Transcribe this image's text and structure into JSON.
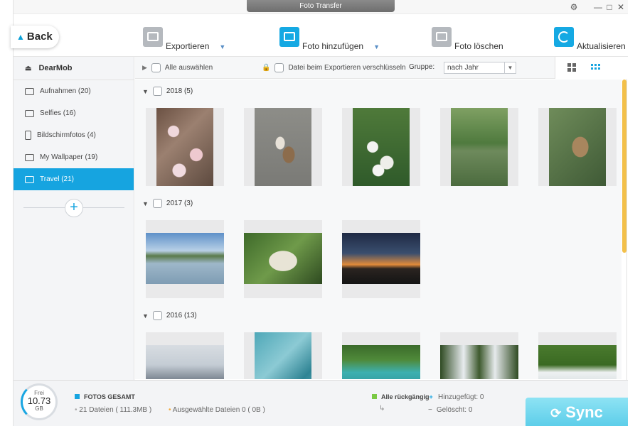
{
  "window": {
    "title": "Foto Transfer"
  },
  "titlebar": {
    "settings_icon": "gear-icon",
    "minimize": "—",
    "maximize": "□",
    "close": "✕"
  },
  "toolbar": {
    "back_label": "Back",
    "export_label": "Exportieren",
    "add_label": "Foto hinzufügen",
    "delete_label": "Foto löschen",
    "refresh_label": "Aktualisieren"
  },
  "sidebar": {
    "device": "DearMob",
    "albums": [
      {
        "label": "Aufnahmen (20)",
        "icon": "camera-icon"
      },
      {
        "label": "Selfies (16)",
        "icon": "camera-icon"
      },
      {
        "label": "Bildschirmfotos (4)",
        "icon": "phone-icon"
      },
      {
        "label": "My Wallpaper (19)",
        "icon": "image-icon"
      },
      {
        "label": "Travel (21)",
        "icon": "image-icon",
        "active": true
      }
    ],
    "add_label": "+"
  },
  "filterbar": {
    "select_all": "Alle auswählen",
    "encrypt": "Datei beim Exportieren verschlüsseln",
    "group_label": "Gruppe:",
    "group_value": "nach Jahr"
  },
  "groups": [
    {
      "label": "2018 (5)"
    },
    {
      "label": "2017 (3)"
    },
    {
      "label": "2016 (13)"
    }
  ],
  "footer": {
    "free_label": "Frei",
    "free_value": "10.73",
    "free_unit": "GB",
    "total_title": "FOTOS GESAMT",
    "files_count": "21 Dateien ( 111.3MB )",
    "selected": "Ausgewählte Dateien 0 ( 0B )",
    "undo_all": "Alle rückgängig",
    "added": "Hinzugefügt: 0",
    "deleted": "Gelöscht: 0",
    "sync_label": "Sync"
  },
  "colors": {
    "accent": "#16a4e0",
    "scroll": "#f3c04a",
    "sync": "#5ccde9",
    "green": "#7ac943"
  }
}
